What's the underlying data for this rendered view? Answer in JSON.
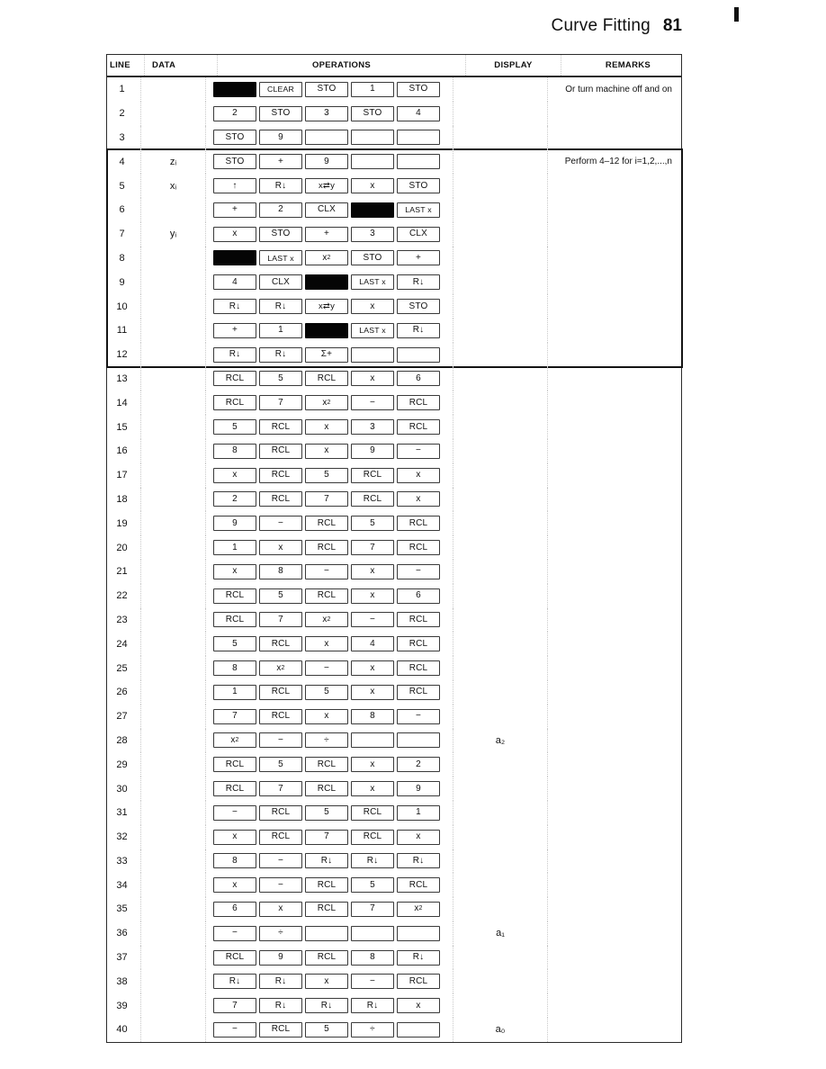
{
  "header": {
    "title": "Curve Fitting",
    "page_number": "81"
  },
  "table": {
    "columns": [
      "LINE",
      "DATA",
      "OPERATIONS",
      "DISPLAY",
      "REMARKS"
    ],
    "loop_note": "Perform 4–12 for i=1,2,...,n",
    "rows": [
      {
        "line": "1",
        "data": "",
        "ops": [
          "FILL",
          "CLEAR",
          "STO",
          "1",
          "STO"
        ],
        "display": "",
        "remarks": "Or turn machine off and on"
      },
      {
        "line": "2",
        "data": "",
        "ops": [
          "2",
          "STO",
          "3",
          "STO",
          "4"
        ],
        "display": "",
        "remarks": ""
      },
      {
        "line": "3",
        "data": "",
        "ops": [
          "STO",
          "9",
          "",
          "",
          ""
        ],
        "display": "",
        "remarks": ""
      },
      {
        "line": "4",
        "data": "zᵢ",
        "ops": [
          "STO",
          "+",
          "9",
          "",
          ""
        ],
        "display": "",
        "remarks": ""
      },
      {
        "line": "5",
        "data": "xᵢ",
        "ops": [
          "↑",
          "R↓",
          "x⇄y",
          "x",
          "STO"
        ],
        "display": "",
        "remarks": ""
      },
      {
        "line": "6",
        "data": "",
        "ops": [
          "+",
          "2",
          "CLX",
          "FILL",
          "LAST x"
        ],
        "display": "",
        "remarks": ""
      },
      {
        "line": "7",
        "data": "yᵢ",
        "ops": [
          "x",
          "STO",
          "+",
          "3",
          "CLX"
        ],
        "display": "",
        "remarks": ""
      },
      {
        "line": "8",
        "data": "",
        "ops": [
          "FILL",
          "LAST x",
          "x²",
          "STO",
          "+"
        ],
        "display": "",
        "remarks": ""
      },
      {
        "line": "9",
        "data": "",
        "ops": [
          "4",
          "CLX",
          "FILL",
          "LAST x",
          "R↓"
        ],
        "display": "",
        "remarks": ""
      },
      {
        "line": "10",
        "data": "",
        "ops": [
          "R↓",
          "R↓",
          "x⇄y",
          "x",
          "STO"
        ],
        "display": "",
        "remarks": ""
      },
      {
        "line": "11",
        "data": "",
        "ops": [
          "+",
          "1",
          "FILL",
          "LAST x",
          "R↓"
        ],
        "display": "",
        "remarks": ""
      },
      {
        "line": "12",
        "data": "",
        "ops": [
          "R↓",
          "R↓",
          "Σ+",
          "",
          ""
        ],
        "display": "",
        "remarks": ""
      },
      {
        "line": "13",
        "data": "",
        "ops": [
          "RCL",
          "5",
          "RCL",
          "x",
          "6"
        ],
        "display": "",
        "remarks": ""
      },
      {
        "line": "14",
        "data": "",
        "ops": [
          "RCL",
          "7",
          "x²",
          "−",
          "RCL"
        ],
        "display": "",
        "remarks": ""
      },
      {
        "line": "15",
        "data": "",
        "ops": [
          "5",
          "RCL",
          "x",
          "3",
          "RCL"
        ],
        "display": "",
        "remarks": ""
      },
      {
        "line": "16",
        "data": "",
        "ops": [
          "8",
          "RCL",
          "x",
          "9",
          "−"
        ],
        "display": "",
        "remarks": ""
      },
      {
        "line": "17",
        "data": "",
        "ops": [
          "x",
          "RCL",
          "5",
          "RCL",
          "x"
        ],
        "display": "",
        "remarks": ""
      },
      {
        "line": "18",
        "data": "",
        "ops": [
          "2",
          "RCL",
          "7",
          "RCL",
          "x"
        ],
        "display": "",
        "remarks": ""
      },
      {
        "line": "19",
        "data": "",
        "ops": [
          "9",
          "−",
          "RCL",
          "5",
          "RCL"
        ],
        "display": "",
        "remarks": ""
      },
      {
        "line": "20",
        "data": "",
        "ops": [
          "1",
          "x",
          "RCL",
          "7",
          "RCL"
        ],
        "display": "",
        "remarks": ""
      },
      {
        "line": "21",
        "data": "",
        "ops": [
          "x",
          "8",
          "−",
          "x",
          "−"
        ],
        "display": "",
        "remarks": ""
      },
      {
        "line": "22",
        "data": "",
        "ops": [
          "RCL",
          "5",
          "RCL",
          "x",
          "6"
        ],
        "display": "",
        "remarks": ""
      },
      {
        "line": "23",
        "data": "",
        "ops": [
          "RCL",
          "7",
          "x²",
          "−",
          "RCL"
        ],
        "display": "",
        "remarks": ""
      },
      {
        "line": "24",
        "data": "",
        "ops": [
          "5",
          "RCL",
          "x",
          "4",
          "RCL"
        ],
        "display": "",
        "remarks": ""
      },
      {
        "line": "25",
        "data": "",
        "ops": [
          "8",
          "x²",
          "−",
          "x",
          "RCL"
        ],
        "display": "",
        "remarks": ""
      },
      {
        "line": "26",
        "data": "",
        "ops": [
          "1",
          "RCL",
          "5",
          "x",
          "RCL"
        ],
        "display": "",
        "remarks": ""
      },
      {
        "line": "27",
        "data": "",
        "ops": [
          "7",
          "RCL",
          "x",
          "8",
          "−"
        ],
        "display": "",
        "remarks": ""
      },
      {
        "line": "28",
        "data": "",
        "ops": [
          "x²",
          "−",
          "÷",
          "",
          ""
        ],
        "display": "a₂",
        "remarks": ""
      },
      {
        "line": "29",
        "data": "",
        "ops": [
          "RCL",
          "5",
          "RCL",
          "x",
          "2"
        ],
        "display": "",
        "remarks": ""
      },
      {
        "line": "30",
        "data": "",
        "ops": [
          "RCL",
          "7",
          "RCL",
          "x",
          "9"
        ],
        "display": "",
        "remarks": ""
      },
      {
        "line": "31",
        "data": "",
        "ops": [
          "−",
          "RCL",
          "5",
          "RCL",
          "1"
        ],
        "display": "",
        "remarks": ""
      },
      {
        "line": "32",
        "data": "",
        "ops": [
          "x",
          "RCL",
          "7",
          "RCL",
          "x"
        ],
        "display": "",
        "remarks": ""
      },
      {
        "line": "33",
        "data": "",
        "ops": [
          "8",
          "−",
          "R↓",
          "R↓",
          "R↓"
        ],
        "display": "",
        "remarks": ""
      },
      {
        "line": "34",
        "data": "",
        "ops": [
          "x",
          "−",
          "RCL",
          "5",
          "RCL"
        ],
        "display": "",
        "remarks": ""
      },
      {
        "line": "35",
        "data": "",
        "ops": [
          "6",
          "x",
          "RCL",
          "7",
          "x²"
        ],
        "display": "",
        "remarks": ""
      },
      {
        "line": "36",
        "data": "",
        "ops": [
          "−",
          "÷",
          "",
          "",
          ""
        ],
        "display": "a₁",
        "remarks": ""
      },
      {
        "line": "37",
        "data": "",
        "ops": [
          "RCL",
          "9",
          "RCL",
          "8",
          "R↓"
        ],
        "display": "",
        "remarks": ""
      },
      {
        "line": "38",
        "data": "",
        "ops": [
          "R↓",
          "R↓",
          "x",
          "−",
          "RCL"
        ],
        "display": "",
        "remarks": ""
      },
      {
        "line": "39",
        "data": "",
        "ops": [
          "7",
          "R↓",
          "R↓",
          "R↓",
          "x"
        ],
        "display": "",
        "remarks": ""
      },
      {
        "line": "40",
        "data": "",
        "ops": [
          "−",
          "RCL",
          "5",
          "÷",
          ""
        ],
        "display": "a₀",
        "remarks": ""
      }
    ]
  }
}
